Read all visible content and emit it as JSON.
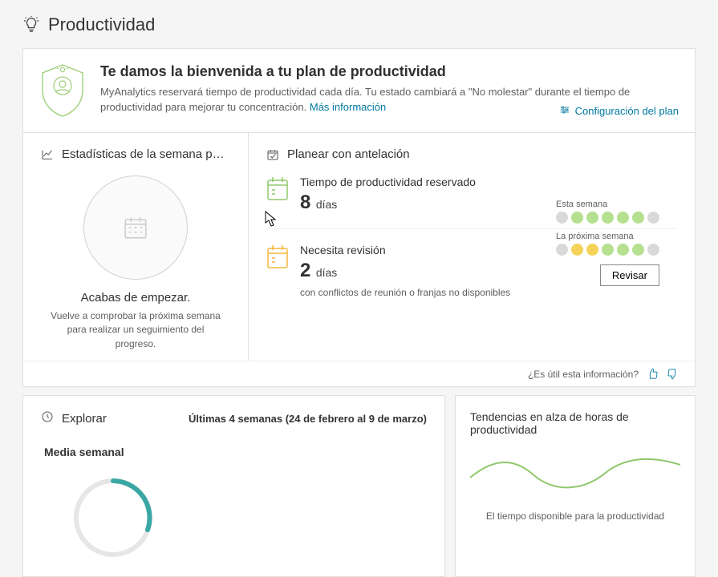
{
  "page": {
    "title": "Productividad"
  },
  "banner": {
    "title": "Te damos la bienvenida a tu plan de productividad",
    "description_prefix": "MyAnalytics reservará tiempo de productividad cada día. Tu estado cambiará a \"No molestar\" durante el tiempo de productividad para mejorar tu concentración. ",
    "learn_more": "Más información",
    "plan_config": "Configuración del plan"
  },
  "stats": {
    "heading": "Estadísticas de la semana p…",
    "empty_title": "Acabas de empezar.",
    "empty_desc": "Vuelve a comprobar la próxima semana para realizar un seguimiento del progreso."
  },
  "plan_ahead": {
    "heading": "Planear con antelación",
    "items": [
      {
        "title": "Tiempo de productividad reservado",
        "value": "8",
        "unit": "días",
        "subtitle": ""
      },
      {
        "title": "Necesita revisión",
        "value": "2",
        "unit": "días",
        "subtitle": "con conflictos de reunión o franjas no disponibles"
      }
    ],
    "this_week_label": "Esta semana",
    "next_week_label": "La próxima semana",
    "revise_label": "Revisar"
  },
  "feedback": {
    "question": "¿Es útil esta información?"
  },
  "explore": {
    "heading": "Explorar",
    "range": "Últimas 4 semanas (24 de febrero al 9 de marzo)",
    "weekly_avg": "Media semanal"
  },
  "trends": {
    "heading": "Tendencias en alza de horas de productividad",
    "desc": "El tiempo disponible para la productividad"
  },
  "colors": {
    "green": "#90c76b",
    "yellow": "#f5d25a",
    "teal": "#3aa7a5",
    "link": "#0078a0"
  }
}
